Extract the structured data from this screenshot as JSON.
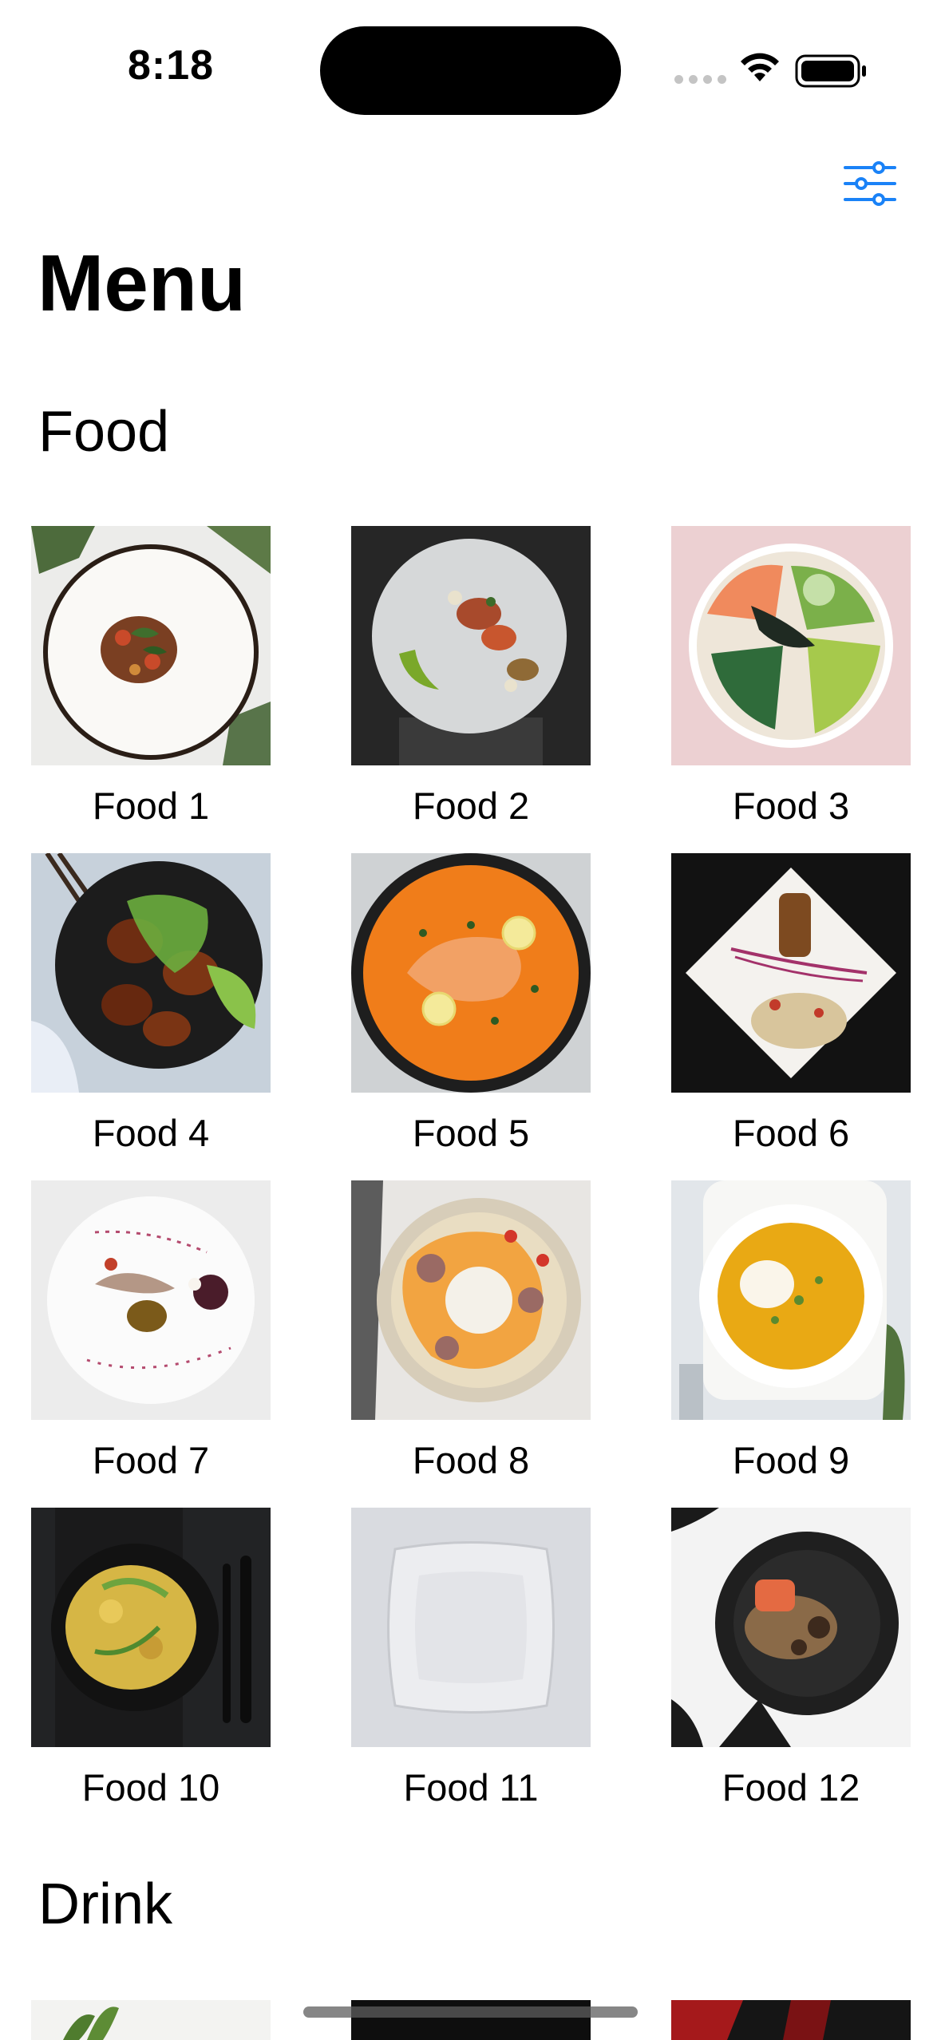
{
  "status_bar": {
    "time": "8:18"
  },
  "nav": {
    "filter_icon": "slider-filter-icon",
    "accent_color": "#1a82f7"
  },
  "page_title": "Menu",
  "sections": {
    "food": {
      "title": "Food",
      "items": [
        {
          "name": "Food 1"
        },
        {
          "name": "Food 2"
        },
        {
          "name": "Food 3"
        },
        {
          "name": "Food 4"
        },
        {
          "name": "Food 5"
        },
        {
          "name": "Food 6"
        },
        {
          "name": "Food 7"
        },
        {
          "name": "Food 8"
        },
        {
          "name": "Food 9"
        },
        {
          "name": "Food 10"
        },
        {
          "name": "Food 11"
        },
        {
          "name": "Food 12"
        }
      ]
    },
    "drink": {
      "title": "Drink"
    }
  }
}
